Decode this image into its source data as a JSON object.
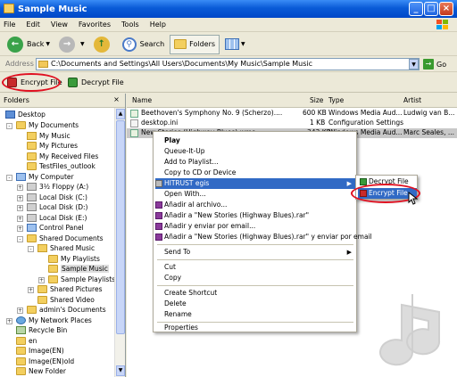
{
  "window": {
    "title": "Sample Music",
    "buttons": [
      "_",
      "□",
      "×"
    ]
  },
  "menu": [
    "File",
    "Edit",
    "View",
    "Favorites",
    "Tools",
    "Help"
  ],
  "toolbar": {
    "back": "Back",
    "search": "Search",
    "folders": "Folders"
  },
  "address": {
    "label": "Address",
    "value": "C:\\Documents and Settings\\All Users\\Documents\\My Music\\Sample Music",
    "go": "Go"
  },
  "encrypt_toolbar": {
    "encrypt": "Encrypt File",
    "decrypt": "Decrypt File"
  },
  "folders": {
    "header": "Folders",
    "close": "×",
    "items": [
      "Desktop",
      "My Documents",
      "My Music",
      "My Pictures",
      "My Received Files",
      "TestFiles_outlook",
      "My Computer",
      "3½ Floppy (A:)",
      "Local Disk (C:)",
      "Local Disk (D:)",
      "Local Disk (E:)",
      "Control Panel",
      "Shared Documents",
      "Shared Music",
      "My Playlists",
      "Sample Music",
      "Sample Playlists",
      "Shared Pictures",
      "Shared Video",
      "admin's Documents",
      "My Network Places",
      "Recycle Bin",
      "en",
      "Image(EN)",
      "Image(EN)old",
      "New Folder"
    ]
  },
  "files": {
    "columns": {
      "name": "Name",
      "size": "Size",
      "type": "Type",
      "artist": "Artist"
    },
    "rows": [
      {
        "name": "Beethoven's Symphony No. 9 (Scherzo)....",
        "size": "600 KB",
        "type": "Windows Media Aud...",
        "artist": "Ludwig van B..."
      },
      {
        "name": "desktop.ini",
        "size": "1 KB",
        "type": "Configuration Settings",
        "artist": ""
      },
      {
        "name": "New Stories (Highway Blues).wma",
        "size": "343 KB",
        "type": "Windows Media Aud...",
        "artist": "Marc Seales, ..."
      }
    ]
  },
  "context_menu": {
    "items": [
      "Play",
      "Queue-It-Up",
      "Add to Playlist...",
      "Copy to CD or Device",
      "HITRUST egis",
      "Open With...",
      "Añadir al archivo...",
      "Añadir a \"New Stories (Highway Blues).rar\"",
      "Añadir y enviar por email...",
      "Añadir a \"New Stories (Highway Blues).rar\" y enviar por email",
      "Send To",
      "Cut",
      "Copy",
      "Create Shortcut",
      "Delete",
      "Rename",
      "Properties"
    ],
    "submenu": [
      "Decrypt File",
      "Encrypt File"
    ]
  },
  "colors": {
    "titlebar": "#0a5bd7",
    "highlight": "#316ac5",
    "ring": "#e01020"
  }
}
